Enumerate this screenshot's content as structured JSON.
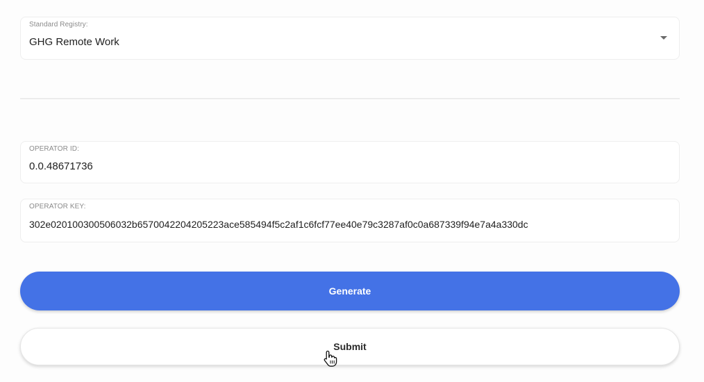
{
  "registry": {
    "label": "Standard Registry:",
    "value": "GHG Remote Work",
    "icon": "chevron-down-icon"
  },
  "operator_id": {
    "label": "OPERATOR ID:",
    "value": "0.0.48671736"
  },
  "operator_key": {
    "label": "OPERATOR KEY:",
    "value": "302e020100300506032b6570042204205223ace585494f5c2af1c6fcf77ee40e79c3287af0c0a687339f94e7a4a330dc"
  },
  "buttons": {
    "generate_label": "Generate",
    "submit_label": "Submit"
  },
  "cursor": {
    "icon": "hand-pointer-icon"
  },
  "colors": {
    "accent": "#4472e6",
    "background": "#fdfdfd"
  }
}
